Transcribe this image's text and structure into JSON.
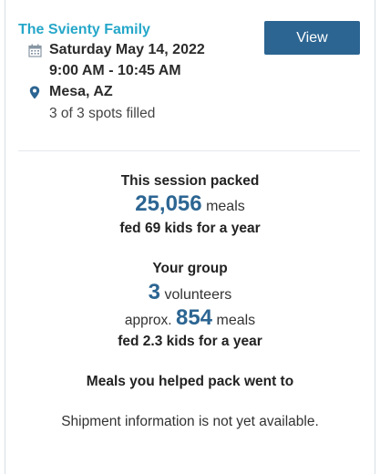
{
  "event": {
    "family_name": "The Svienty Family",
    "date": "Saturday May 14, 2022",
    "time": "9:00 AM - 10:45 AM",
    "location": "Mesa, AZ",
    "spots": "3 of 3 spots filled",
    "view_label": "View"
  },
  "session": {
    "heading": "This session packed",
    "meals_count": "25,056",
    "meals_unit": "meals",
    "impact": "fed 69 kids for a year"
  },
  "group": {
    "heading": "Your group",
    "volunteers_count": "3",
    "volunteers_unit": "volunteers",
    "approx_label": "approx.",
    "meals_count": "854",
    "meals_unit": "meals",
    "impact": "fed 2.3 kids for a year"
  },
  "shipment": {
    "heading": "Meals you helped pack went to",
    "status": "Shipment information is not yet available."
  },
  "colors": {
    "accent": "#26a7c9",
    "button": "#2c6592",
    "number": "#2c6592"
  },
  "icons": {
    "date": "calendar-icon",
    "location": "map-pin-icon"
  }
}
